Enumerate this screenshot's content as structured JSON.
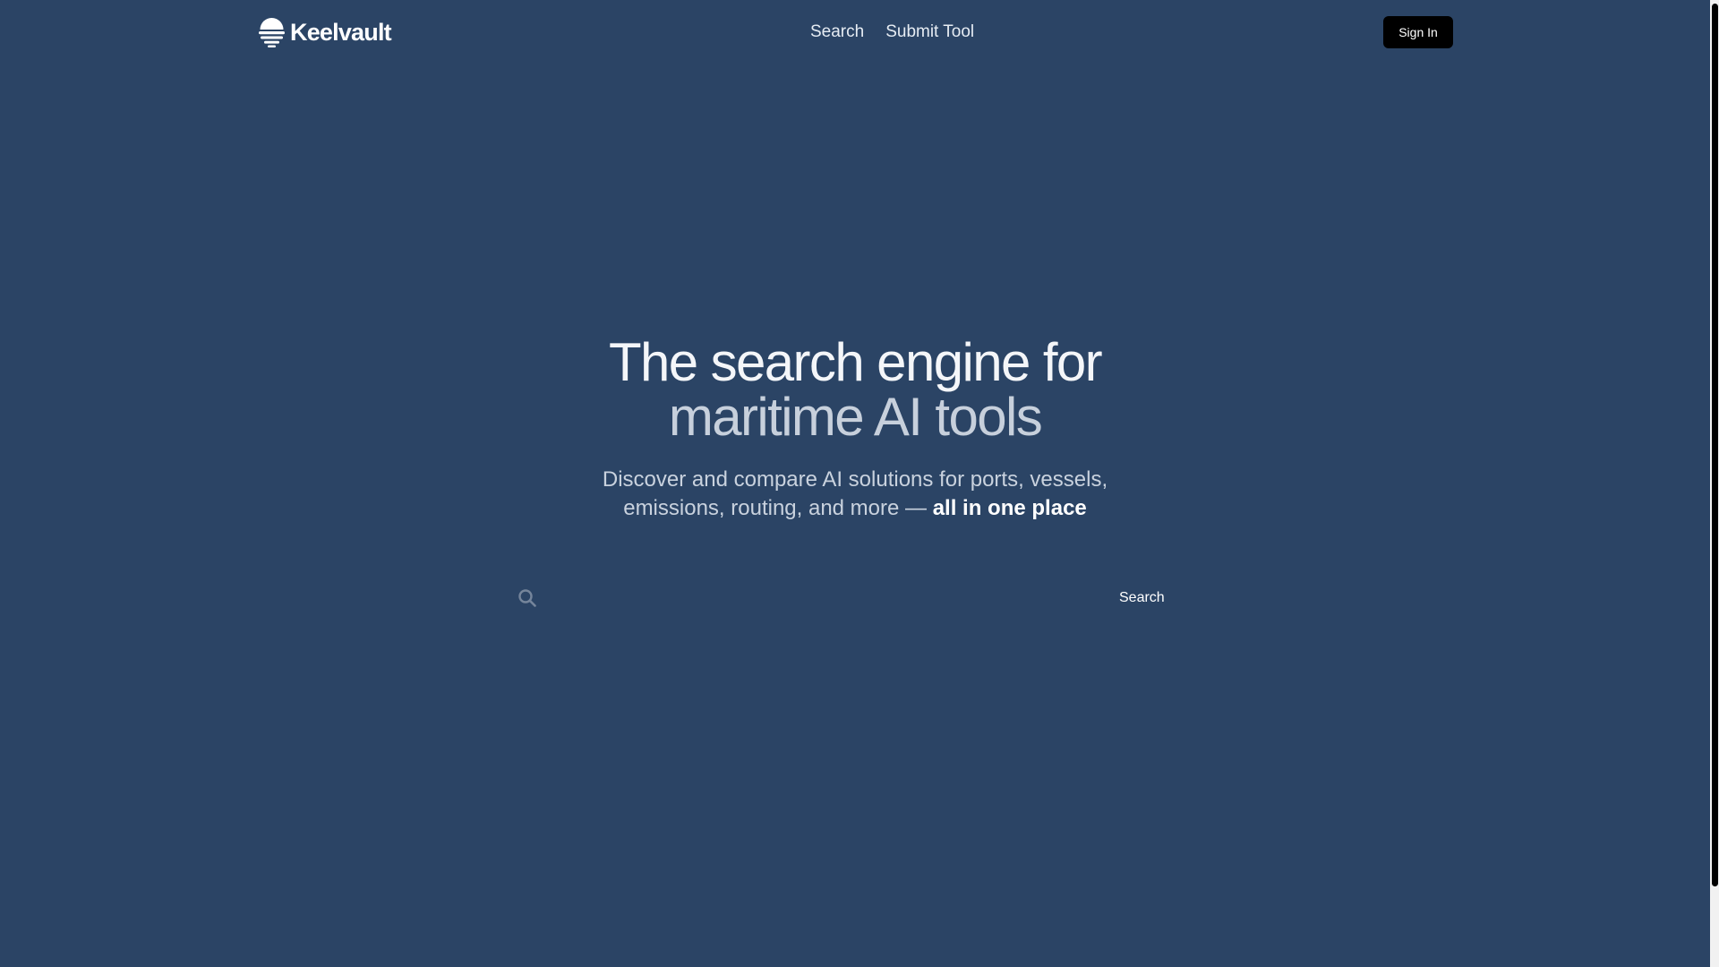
{
  "brand": {
    "name": "Keelvault",
    "logo_icon": "sunset-waves-logo"
  },
  "nav": {
    "items": [
      {
        "label": "Search"
      },
      {
        "label": "Submit Tool"
      }
    ]
  },
  "header": {
    "signin_label": "Sign In"
  },
  "hero": {
    "title_line1": "The search engine for",
    "title_line2": "maritime AI tools",
    "subtitle_line1": "Discover and compare AI solutions for ports, vessels,",
    "subtitle_line2_prefix": "emissions, routing, and more — ",
    "subtitle_emphasis": "all in one place"
  },
  "search": {
    "icon": "search-icon",
    "value": "",
    "submit_label": "Search"
  },
  "colors": {
    "background": "#2b4465",
    "button_bg": "#000000",
    "title_primary": "#f4f6f9",
    "title_secondary": "#c7d0dc"
  }
}
